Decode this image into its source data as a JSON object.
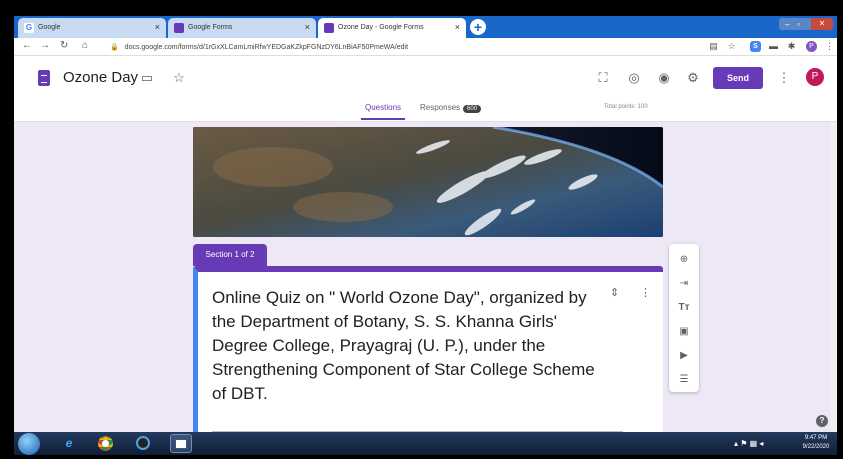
{
  "browser": {
    "tabs": [
      {
        "label": "Google",
        "icon": "google-icon",
        "active": false
      },
      {
        "label": "Google Forms",
        "icon": "forms-icon",
        "active": false
      },
      {
        "label": "Ozone Day - Google Forms",
        "icon": "forms-icon",
        "active": true
      }
    ],
    "tab_close": "×",
    "new_tab": "+",
    "url": "docs.google.com/forms/d/1rGxXLCamLmiRfwYEDGaKZkpFGNzDY6LnBiAF50PmeWA/edit"
  },
  "header": {
    "title": "Ozone Day",
    "send_label": "Send",
    "avatar_letter": "P",
    "tab_questions": "Questions",
    "tab_responses": "Responses",
    "responses_count": "600",
    "total_points": "Total points: 100"
  },
  "section": {
    "label": "Section 1 of 2",
    "title": "Online Quiz on \" World Ozone Day\", organized by the Department of Botany, S. S. Khanna Girls' Degree College, Prayagraj (U. P.), under  the Strengthening Component of Star College Scheme of DBT."
  },
  "taskbar": {
    "time": "9:47 PM",
    "date": "9/22/2020"
  },
  "colors": {
    "accent": "#673ab7",
    "tabstrip": "#1a66c9",
    "avatar": "#c2185b",
    "section_border": "#4285f4"
  }
}
